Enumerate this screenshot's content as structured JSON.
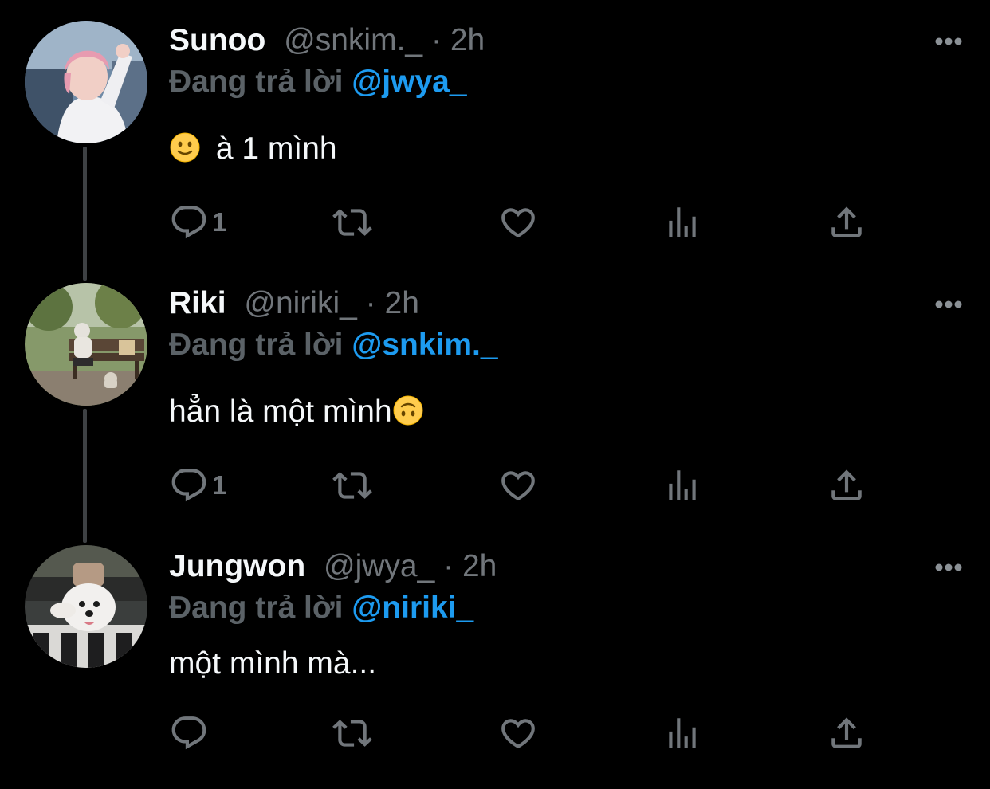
{
  "tweets": [
    {
      "display_name": "Sunoo",
      "handle": "@snkim._",
      "time": "2h",
      "replying_label": "Đang trả lời",
      "replying_to": "@jwya_",
      "emoji_before": "slightly-smiling-face",
      "text": "à 1 mình",
      "reply_count": "1",
      "avatar": "pink-haired-person-avatar"
    },
    {
      "display_name": "Riki",
      "handle": "@niriki_",
      "time": "2h",
      "replying_label": "Đang trả lời",
      "replying_to": "@snkim._",
      "text": "hẳn là một mình",
      "emoji_after": "upside-down-face",
      "reply_count": "1",
      "avatar": "person-on-park-bench-avatar"
    },
    {
      "display_name": "Jungwon",
      "handle": "@jwya_",
      "time": "2h",
      "replying_label": "Đang trả lời",
      "replying_to": "@niriki_",
      "text": "một mình mà...",
      "reply_count": "",
      "avatar": "person-with-white-dog-avatar"
    }
  ],
  "separator": "·",
  "icons": [
    "reply-icon",
    "retweet-icon",
    "like-icon",
    "analytics-icon",
    "share-icon",
    "more-icon"
  ],
  "colors": {
    "background": "#000000",
    "mention": "#1d9bf0",
    "muted": "#71767b",
    "thread_line": "#3e4144"
  }
}
